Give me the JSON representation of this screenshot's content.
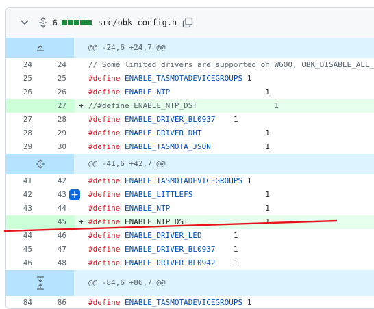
{
  "file": {
    "change_count": "6",
    "path": "src/obk_config.h",
    "diffstat_color": "#1f883d",
    "icons": [
      "chevron-down-icon",
      "unfold-icon",
      "copy-icon"
    ]
  },
  "hunks": [
    {
      "header": "@@ -24,6 +24,7 @@",
      "lines": [
        {
          "o": "24",
          "n": "24",
          "type": "ctx",
          "kw": "",
          "id": "",
          "rest": "",
          "comment": "// Some limited drivers are supported on W600, OBK_DISABLE_ALL_"
        },
        {
          "o": "25",
          "n": "25",
          "type": "ctx",
          "kw": "#define",
          "id": "ENABLE_TASMOTADEVICEGROUPS",
          "rest": " 1"
        },
        {
          "o": "26",
          "n": "26",
          "type": "ctx",
          "kw": "#define",
          "id": "ENABLE_NTP",
          "rest": "                     1"
        },
        {
          "o": "",
          "n": "27",
          "type": "add",
          "kw": "",
          "id": "",
          "rest": "",
          "comment": "//#define ENABLE_NTP_DST                 1"
        },
        {
          "o": "27",
          "n": "28",
          "type": "ctx",
          "kw": "#define",
          "id": "ENABLE_DRIVER_BL0937",
          "rest": "    1"
        },
        {
          "o": "28",
          "n": "29",
          "type": "ctx",
          "kw": "#define",
          "id": "ENABLE_DRIVER_DHT",
          "rest": "              1"
        },
        {
          "o": "29",
          "n": "30",
          "type": "ctx",
          "kw": "#define",
          "id": "ENABLE_TASMOTA_JSON",
          "rest": "            1"
        }
      ]
    },
    {
      "header": "@@ -41,6 +42,7 @@",
      "lines": [
        {
          "o": "41",
          "n": "42",
          "type": "ctx",
          "kw": "#define",
          "id": "ENABLE_TASMOTADEVICEGROUPS",
          "rest": " 1"
        },
        {
          "o": "42",
          "n": "43",
          "type": "ctx",
          "kw": "#define",
          "id": "ENABLE_LITTLEFS",
          "rest": "                1"
        },
        {
          "o": "43",
          "n": "44",
          "type": "ctx",
          "kw": "#define",
          "id": "ENABLE_NTP",
          "rest": "                     1"
        },
        {
          "o": "",
          "n": "45",
          "type": "add",
          "kw": "#define",
          "id": "",
          "rest": " ENABLE_NTP_DST                 1"
        },
        {
          "o": "44",
          "n": "46",
          "type": "ctx",
          "kw": "#define",
          "id": "ENABLE_DRIVER_LED",
          "rest": "       1"
        },
        {
          "o": "45",
          "n": "47",
          "type": "ctx",
          "kw": "#define",
          "id": "ENABLE_DRIVER_BL0937",
          "rest": "    1"
        },
        {
          "o": "46",
          "n": "48",
          "type": "ctx",
          "kw": "#define",
          "id": "ENABLE_DRIVER_BL0942",
          "rest": "    1"
        }
      ]
    },
    {
      "header": "@@ -84,6 +86,7 @@",
      "lines": [
        {
          "o": "84",
          "n": "86",
          "type": "ctx",
          "kw": "#define",
          "id": "ENABLE_TASMOTADEVICEGROUPS",
          "rest": " 1"
        }
      ]
    }
  ],
  "add_line_button": "+",
  "add_marker": "+"
}
